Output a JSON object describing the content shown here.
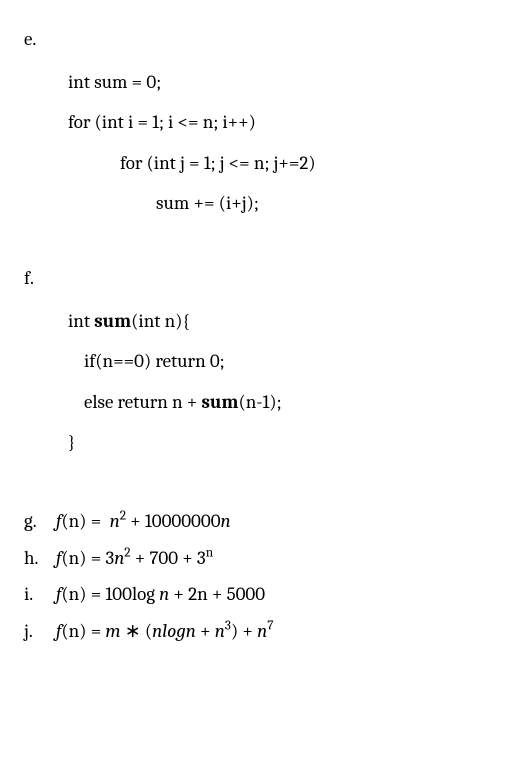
{
  "items": {
    "e": {
      "label": "e.",
      "lines": [
        "int sum = 0;",
        "for (int i = 1; i <= n; i++)",
        "for (int j = 1; j <= n; j+=2)",
        "sum += (i+j);"
      ]
    },
    "f": {
      "label": "f.",
      "line1_pre": "int ",
      "line1_bold": "sum",
      "line1_post": "(int n){",
      "line2": "if(n==0) return 0;",
      "line3_pre": "else return n + ",
      "line3_bold": "sum",
      "line3_post": "(n-1);",
      "line4": "}"
    },
    "g": {
      "label": "g.",
      "fn": "f",
      "arg": "(n)",
      "eq": " = ",
      "rhs_parts": [
        "n",
        "² + 10000000",
        "n"
      ]
    },
    "h": {
      "label": "h.",
      "fn": "f",
      "arg": "(n)",
      "eq": " = ",
      "rhs_parts": [
        "3",
        "n",
        "² + 700 +  3",
        "ⁿ"
      ]
    },
    "i": {
      "label": "i.",
      "fn": "f",
      "arg": "(n)",
      "eq": " = ",
      "rhs_parts": [
        "100log ",
        "n",
        " + 2n + 5000"
      ]
    },
    "j": {
      "label": "j.",
      "fn": "f",
      "arg": "(n)",
      "eq": " = ",
      "rhs_parts": [
        "m",
        " ∗ (",
        "nlogn",
        " + ",
        "n",
        "³) + ",
        "n",
        "⁷"
      ]
    }
  }
}
